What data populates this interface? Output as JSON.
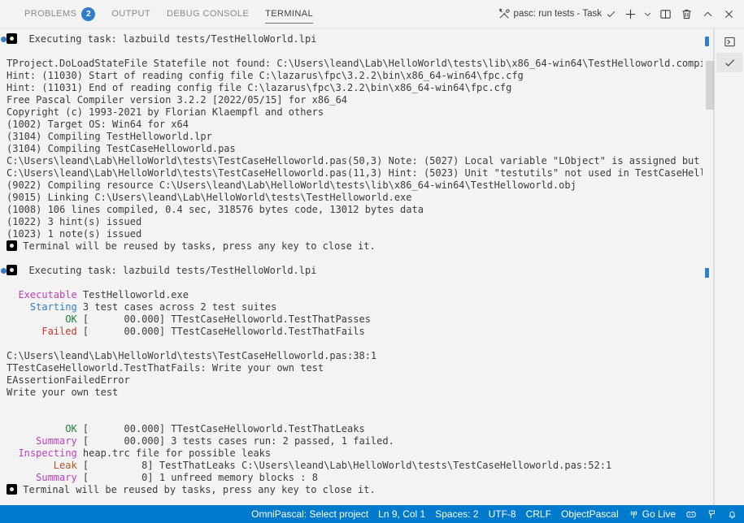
{
  "panel": {
    "tabs": [
      {
        "label": "PROBLEMS",
        "badge": "2",
        "active": false
      },
      {
        "label": "OUTPUT",
        "badge": null,
        "active": false
      },
      {
        "label": "DEBUG CONSOLE",
        "badge": null,
        "active": false
      },
      {
        "label": "TERMINAL",
        "badge": null,
        "active": true
      }
    ],
    "actions": {
      "terminal_selector_icon": "tools-icon",
      "terminal_selector_label": "pasc: run tests - Task",
      "selector_check_icon": "check-icon",
      "new_terminal_icon": "plus-icon",
      "new_terminal_dropdown_icon": "chevron-down-icon",
      "split_terminal_icon": "split-panel-icon",
      "kill_terminal_icon": "trash-icon",
      "maximize_panel_icon": "chevron-up-icon",
      "close_panel_icon": "close-icon"
    },
    "side_list": [
      {
        "icon": "terminal-chevron-icon",
        "selected": false
      },
      {
        "icon": "check-icon",
        "selected": true
      }
    ]
  },
  "accent": {
    "statusbar_bg": "#007acc",
    "badge_bg": "#2f7ec7",
    "decoration_blue": "#2f7ec7",
    "ansi_green": "#1a7f37",
    "ansi_red": "#c0392b",
    "ansi_magenta": "#bc3fbc",
    "ansi_blue": "#2f7ec7",
    "ansi_orange": "#b5562a"
  },
  "terminal": {
    "lines": [
      {
        "type": "command",
        "icon": "terminal-icon",
        "text": "Executing task: lazbuild tests/TestHelloWorld.lpi"
      },
      {
        "type": "blank",
        "text": ""
      },
      {
        "type": "plain",
        "text": "TProject.DoLoadStateFile Statefile not found: C:\\Users\\leand\\Lab\\HelloWorld\\tests\\lib\\x86_64-win64\\TestHelloworld.compiled"
      },
      {
        "type": "plain",
        "text": "Hint: (11030) Start of reading config file C:\\lazarus\\fpc\\3.2.2\\bin\\x86_64-win64\\fpc.cfg"
      },
      {
        "type": "plain",
        "text": "Hint: (11031) End of reading config file C:\\lazarus\\fpc\\3.2.2\\bin\\x86_64-win64\\fpc.cfg"
      },
      {
        "type": "plain",
        "text": "Free Pascal Compiler version 3.2.2 [2022/05/15] for x86_64"
      },
      {
        "type": "plain",
        "text": "Copyright (c) 1993-2021 by Florian Klaempfl and others"
      },
      {
        "type": "plain",
        "text": "(1002) Target OS: Win64 for x64"
      },
      {
        "type": "plain",
        "text": "(3104) Compiling TestHelloworld.lpr"
      },
      {
        "type": "plain",
        "text": "(3104) Compiling TestCaseHelloworld.pas"
      },
      {
        "type": "plain",
        "text": "C:\\Users\\leand\\Lab\\HelloWorld\\tests\\TestCaseHelloworld.pas(50,3) Note: (5027) Local variable \"LObject\" is assigned but never used"
      },
      {
        "type": "plain",
        "text": "C:\\Users\\leand\\Lab\\HelloWorld\\tests\\TestCaseHelloworld.pas(11,3) Hint: (5023) Unit \"testutils\" not used in TestCaseHelloworld"
      },
      {
        "type": "plain",
        "text": "(9022) Compiling resource C:\\Users\\leand\\Lab\\HelloWorld\\tests\\lib\\x86_64-win64\\TestHelloworld.obj"
      },
      {
        "type": "plain",
        "text": "(9015) Linking C:\\Users\\leand\\Lab\\HelloWorld\\tests\\TestHelloworld.exe"
      },
      {
        "type": "plain",
        "text": "(1008) 106 lines compiled, 0.4 sec, 318576 bytes code, 13012 bytes data"
      },
      {
        "type": "plain",
        "text": "(1022) 3 hint(s) issued"
      },
      {
        "type": "plain",
        "text": "(1023) 1 note(s) issued"
      },
      {
        "type": "notice",
        "icon": "terminal-icon",
        "text": "Terminal will be reused by tasks, press any key to close it."
      },
      {
        "type": "blank",
        "text": ""
      },
      {
        "type": "command",
        "icon": "terminal-icon",
        "text": "Executing task: lazbuild tests/TestHelloWorld.lpi"
      },
      {
        "type": "blank",
        "text": ""
      },
      {
        "type": "ansi",
        "segments": [
          {
            "text": "  Executable",
            "color": "magenta"
          },
          {
            "text": " TestHelloworld.exe",
            "color": "default"
          }
        ]
      },
      {
        "type": "ansi",
        "segments": [
          {
            "text": "    Starting",
            "color": "blue"
          },
          {
            "text": " 3 test cases across 2 test suites",
            "color": "default"
          }
        ]
      },
      {
        "type": "ansi",
        "segments": [
          {
            "text": "          OK",
            "color": "green"
          },
          {
            "text": " [      00.000] TTestCaseHelloworld.TestThatPasses",
            "color": "default"
          }
        ]
      },
      {
        "type": "ansi",
        "segments": [
          {
            "text": "      Failed",
            "color": "red"
          },
          {
            "text": " [      00.000] TTestCaseHelloworld.TestThatFails",
            "color": "default"
          }
        ]
      },
      {
        "type": "blank",
        "text": ""
      },
      {
        "type": "plain",
        "text": "C:\\Users\\leand\\Lab\\HelloWorld\\tests\\TestCaseHelloworld.pas:38:1"
      },
      {
        "type": "plain",
        "text": "TTestCaseHelloworld.TestThatFails: Write your own test"
      },
      {
        "type": "plain",
        "text": "EAssertionFailedError"
      },
      {
        "type": "plain",
        "text": "Write your own test"
      },
      {
        "type": "blank",
        "text": ""
      },
      {
        "type": "blank",
        "text": ""
      },
      {
        "type": "ansi",
        "segments": [
          {
            "text": "          OK",
            "color": "green"
          },
          {
            "text": " [      00.000] TTestCaseHelloworld.TestThatLeaks",
            "color": "default"
          }
        ]
      },
      {
        "type": "ansi",
        "segments": [
          {
            "text": "     Summary",
            "color": "magenta"
          },
          {
            "text": " [      00.000] 3 tests cases run: 2 passed, 1 failed.",
            "color": "default"
          }
        ]
      },
      {
        "type": "ansi",
        "segments": [
          {
            "text": "  Inspecting",
            "color": "magenta"
          },
          {
            "text": " heap.trc file for possible leaks",
            "color": "default"
          }
        ]
      },
      {
        "type": "ansi",
        "segments": [
          {
            "text": "        Leak",
            "color": "orange"
          },
          {
            "text": " [         8] TestThatLeaks C:\\Users\\leand\\Lab\\HelloWorld\\tests\\TestCaseHelloworld.pas:52:1",
            "color": "default"
          }
        ]
      },
      {
        "type": "ansi",
        "segments": [
          {
            "text": "     Summary",
            "color": "magenta"
          },
          {
            "text": " [         0] 1 unfreed memory blocks : 8",
            "color": "default"
          }
        ]
      },
      {
        "type": "notice",
        "icon": "terminal-icon",
        "text": "Terminal will be reused by tasks, press any key to close it."
      }
    ]
  },
  "statusbar": {
    "items": [
      {
        "label": "OmniPascal: Select project",
        "icon": null
      },
      {
        "label": "Ln 9, Col 1",
        "icon": null
      },
      {
        "label": "Spaces: 2",
        "icon": null
      },
      {
        "label": "UTF-8",
        "icon": null
      },
      {
        "label": "CRLF",
        "icon": null
      },
      {
        "label": "ObjectPascal",
        "icon": null
      },
      {
        "label": "Go Live",
        "icon": "broadcast-icon"
      },
      {
        "label": "",
        "icon": "smiley-feedback-icon"
      },
      {
        "label": "",
        "icon": "remote-window-icon"
      },
      {
        "label": "",
        "icon": "bell-icon"
      }
    ]
  }
}
